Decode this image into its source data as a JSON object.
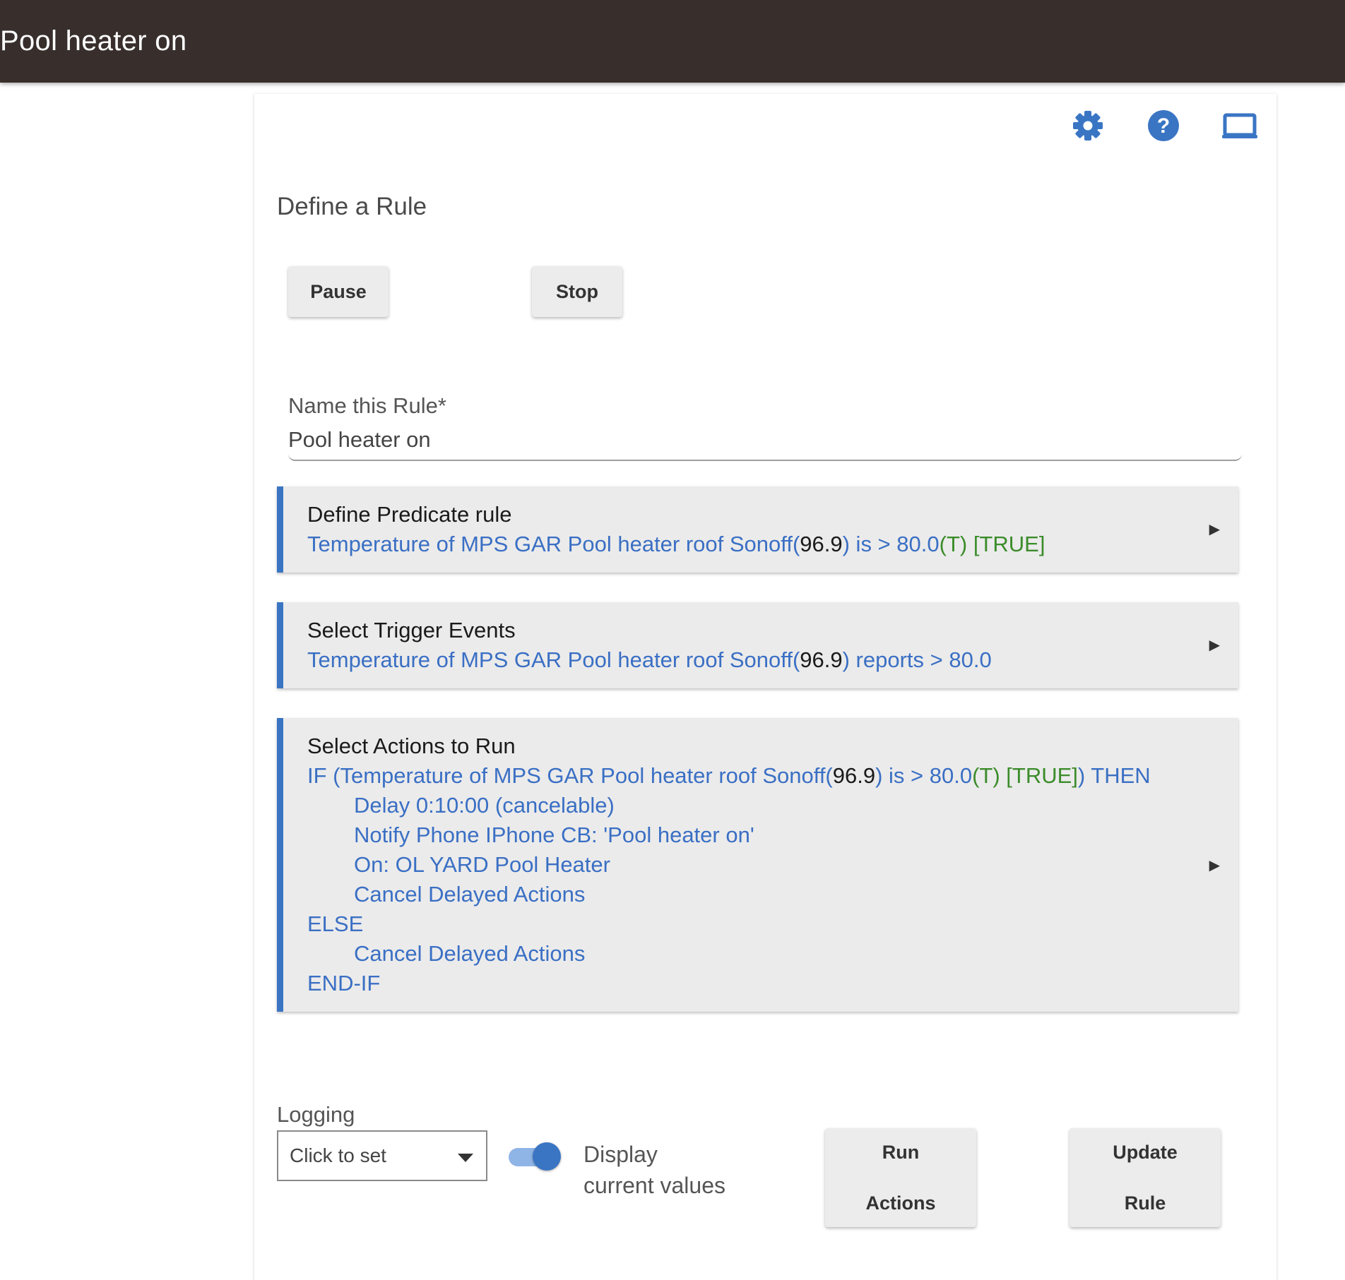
{
  "header": {
    "title": "Pool heater on"
  },
  "toolbar": {
    "icons": [
      "gear-icon",
      "help-icon",
      "display-icon"
    ],
    "accent": "#3a75c4"
  },
  "page": {
    "title": "Define a Rule"
  },
  "controls": {
    "pause_label": "Pause",
    "stop_label": "Stop"
  },
  "name_field": {
    "label": "Name this Rule*",
    "value": "Pool heater on"
  },
  "predicate": {
    "title": "Define Predicate rule",
    "line": {
      "prefix": "Temperature of MPS GAR Pool heater roof Sonoff(",
      "value": "96.9",
      "middle": ") is > 80.0",
      "state": "(T) [TRUE]"
    }
  },
  "triggers": {
    "title": "Select Trigger Events",
    "line": {
      "prefix": "Temperature of MPS GAR Pool heater roof Sonoff(",
      "value": "96.9",
      "suffix": ") reports > 80.0"
    }
  },
  "actions": {
    "title": "Select Actions to Run",
    "if_line": {
      "prefix": "IF (Temperature of MPS GAR Pool heater roof Sonoff(",
      "value": "96.9",
      "middle": ") is > 80.0",
      "state": "(T) [TRUE]",
      "suffix": ") THEN"
    },
    "then_items": [
      "Delay 0:10:00 (cancelable)",
      "Notify Phone IPhone CB: 'Pool heater on'",
      "On: OL YARD Pool Heater",
      "Cancel Delayed Actions"
    ],
    "else_label": "ELSE",
    "else_items": [
      "Cancel Delayed Actions"
    ],
    "end_label": "END-IF"
  },
  "logging": {
    "label": "Logging",
    "select_value": "Click to set"
  },
  "display_toggle": {
    "label_line1": "Display",
    "label_line2": "current values",
    "on": true
  },
  "buttons": {
    "run_line1": "Run",
    "run_line2": "Actions",
    "update_line1": "Update",
    "update_line2": "Rule"
  }
}
